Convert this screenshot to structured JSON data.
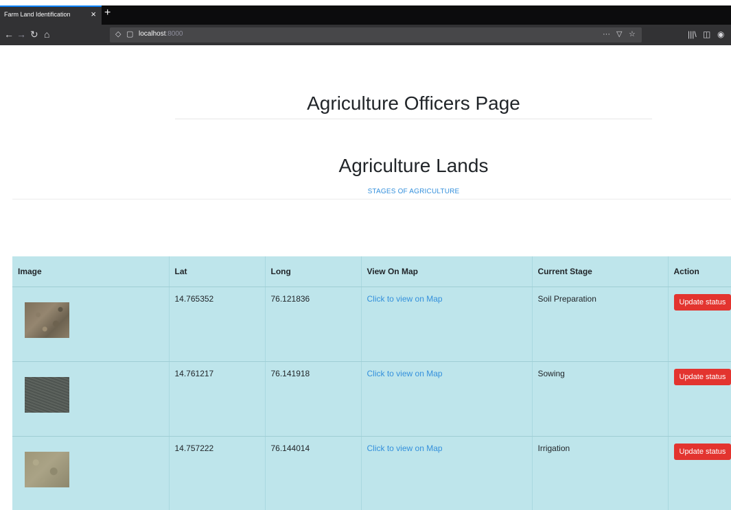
{
  "browser": {
    "tab_title": "Farm Land Identification",
    "tab_close": "×",
    "new_tab": "+",
    "url_host": "localhost",
    "url_port": ":8000",
    "icons": {
      "back": "←",
      "forward": "→",
      "reload": "↻",
      "home": "⌂",
      "shield": "◇",
      "page": "▢",
      "more": "···",
      "pocket": "▽",
      "bookmark": "☆",
      "library": "|||\\",
      "sidebar": "◫",
      "account": "◉"
    }
  },
  "page": {
    "title": "Agriculture Officers Page",
    "section_title": "Agriculture Lands",
    "section_subtitle": "STAGES OF AGRICULTURE"
  },
  "table": {
    "headers": [
      "Image",
      "Lat",
      "Long",
      "View On Map",
      "Current Stage",
      "Action"
    ],
    "rows": [
      {
        "lat": "14.765352",
        "long": "76.121836",
        "map_link": "Click to view on Map",
        "stage": "Soil Preparation",
        "action": "Update status"
      },
      {
        "lat": "14.761217",
        "long": "76.141918",
        "map_link": "Click to view on Map",
        "stage": "Sowing",
        "action": "Update status"
      },
      {
        "lat": "14.757222",
        "long": "76.144014",
        "map_link": "Click to view on Map",
        "stage": "Irrigation",
        "action": "Update status"
      }
    ]
  },
  "colors": {
    "table_bg": "#bee5eb",
    "link": "#3490dc",
    "button": "#e3342f",
    "tab_accent": "#0a84ff"
  }
}
